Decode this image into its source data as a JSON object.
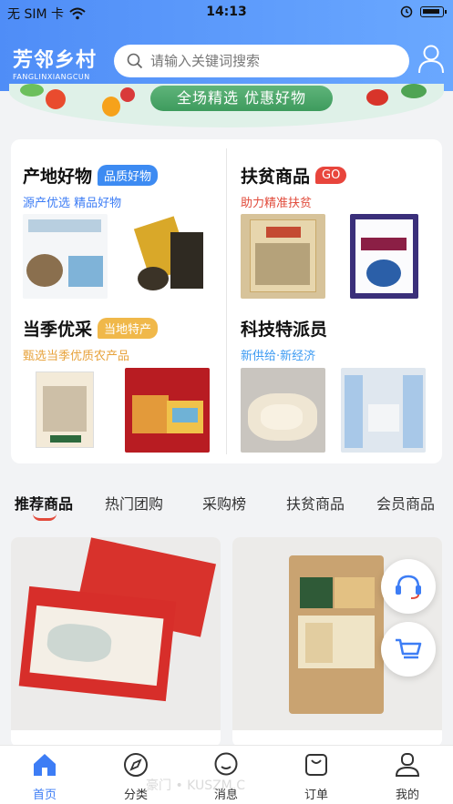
{
  "status_bar": {
    "carrier": "无 SIM 卡",
    "time": "14:13"
  },
  "header": {
    "logo_cn": "芳邻乡村",
    "logo_en": "FANGLINXIANGCUN",
    "search_placeholder": "请输入关键词搜索"
  },
  "banner": {
    "text": "全场精选 优惠好物"
  },
  "categories": [
    {
      "title": "产地好物",
      "badge": "品质好物",
      "badge_color": "#3d8bf2",
      "subtitle": "源产优选 精品好物",
      "subtitle_color": "#3d7df5"
    },
    {
      "title": "扶贫商品",
      "badge": "GO",
      "badge_color": "#e8453c",
      "subtitle": "助力精准扶贫",
      "subtitle_color": "#e14b3b"
    },
    {
      "title": "当季优采",
      "badge": "当地特产",
      "badge_color": "#f0b84a",
      "subtitle": "甄选当季优质农产品",
      "subtitle_color": "#e7a23b"
    },
    {
      "title": "科技特派员",
      "badge": "",
      "badge_color": "",
      "subtitle": "新供给·新经济",
      "subtitle_color": "#3d9bf2"
    }
  ],
  "tabs": [
    "推荐商品",
    "热门团购",
    "采购榜",
    "扶贫商品",
    "会员商品"
  ],
  "bottom_nav": [
    "首页",
    "分类",
    "消息",
    "订单",
    "我的"
  ],
  "watermark": "豪门 • KUSZM.C",
  "colors": {
    "primary": "#3d7df5",
    "accent_red": "#e24a3b"
  },
  "icons": [
    "wifi-icon",
    "alarm-icon",
    "battery-icon",
    "search-icon",
    "user-icon",
    "headset-icon",
    "cart-icon",
    "home-icon",
    "compass-icon",
    "message-icon",
    "order-icon",
    "profile-icon"
  ]
}
